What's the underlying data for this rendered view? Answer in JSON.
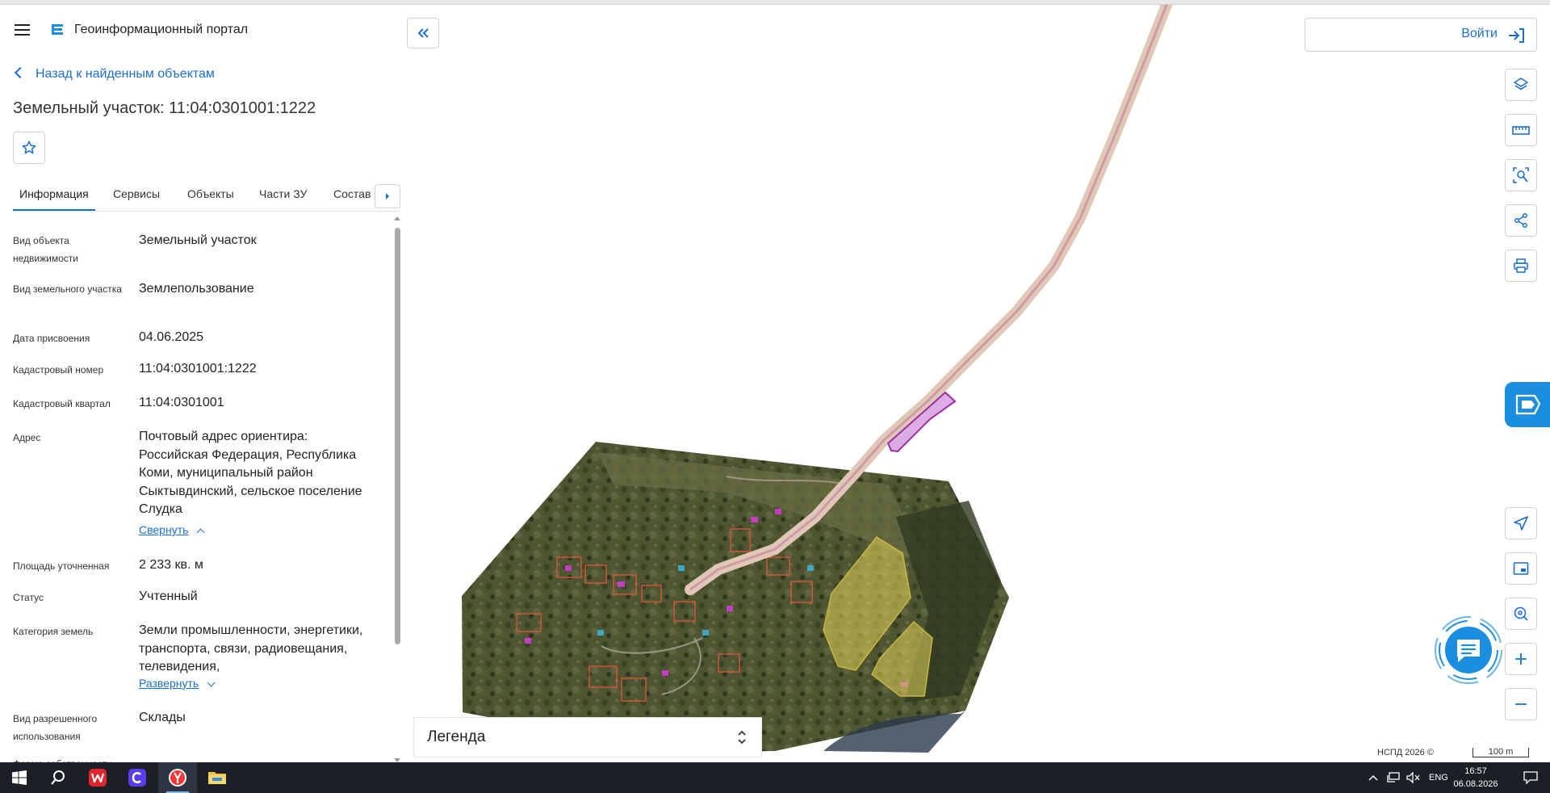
{
  "header": {
    "portal_title": "Геоинформационный портал",
    "back_link": "Назад к найденным объектам",
    "object_title": "Земельный участок: 11:04:0301001:1222"
  },
  "tabs": [
    "Информация",
    "Сервисы",
    "Объекты",
    "Части ЗУ",
    "Состав"
  ],
  "properties": {
    "object_type_label": "Вид объекта недвижимости",
    "object_type_value": "Земельный участок",
    "land_plot_type_label": "Вид земельного участка",
    "land_plot_type_value": "Землепользование",
    "assign_date_label": "Дата присвоения",
    "assign_date_value": "04.06.2025",
    "cadastral_number_label": "Кадастровый номер",
    "cadastral_number_value": "11:04:0301001:1222",
    "cadastral_quarter_label": "Кадастровый квартал",
    "cadastral_quarter_value": "11:04:0301001",
    "address_label": "Адрес",
    "address_value": "Почтовый адрес ориентира: Российская Федерация, Республика Коми, муниципальный район Сыктывдинский, сельское поселение Слудка",
    "collapse_link": "Свернуть",
    "area_label": "Площадь уточненная",
    "area_value": "2 233 кв. м",
    "status_label": "Статус",
    "status_value": "Учтенный",
    "land_category_label": "Категория земель",
    "land_category_value": "Земли промышленности, энергетики, транспорта, связи, радиовещания, телевидения,",
    "expand_link": "Развернуть",
    "permitted_use_label": "Вид разрешенного использования",
    "permitted_use_value": "Склады",
    "ownership_label": "Форма собственности",
    "ownership_value": "-"
  },
  "map": {
    "login_label": "Войти",
    "legend_label": "Легенда",
    "copyright": "НСПД 2026 ©",
    "scale_label": "100 m"
  },
  "icons": {
    "tools": [
      "layers-icon",
      "ruler-icon",
      "area-select-icon",
      "share-icon",
      "print-icon",
      "navigate-icon",
      "minimap-icon",
      "location-search-icon",
      "zoom-in-icon",
      "zoom-out-icon"
    ]
  },
  "taskbar": {
    "lang": "ENG",
    "time": "16:57",
    "date": "06.08.2026"
  },
  "colors": {
    "accent": "#1b6fd1",
    "side_tab": "#1b8ee0",
    "parcel_magenta": "#b04fb6",
    "zone_yellow": "#e3d35a"
  }
}
